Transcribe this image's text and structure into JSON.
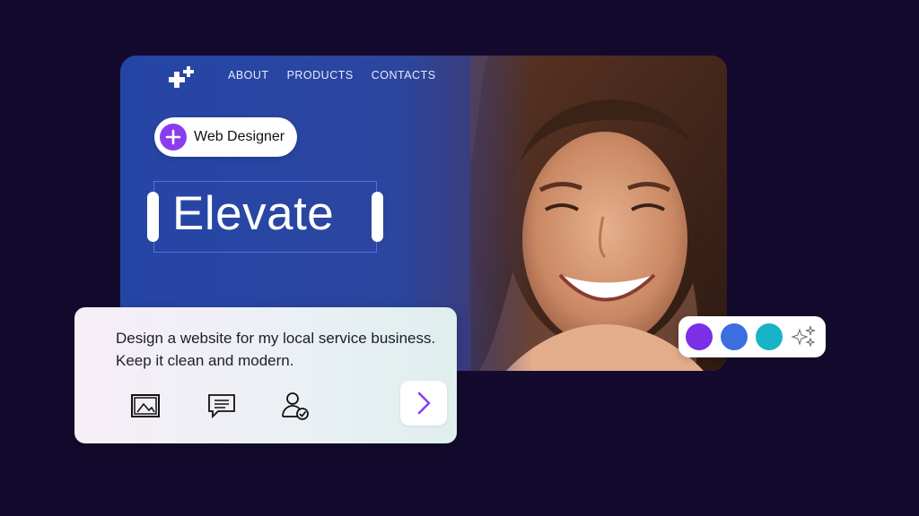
{
  "nav": {
    "items": [
      "ABOUT",
      "PRODUCTS",
      "CONTACTS"
    ]
  },
  "badge": {
    "label": "Web Designer",
    "icon": "plus-icon",
    "color": "#8a3df0"
  },
  "headline": {
    "text": "Elevate"
  },
  "prompt": {
    "text": "Design a website for my local service business. Keep it clean and modern.",
    "tools": [
      "image-icon",
      "chat-icon",
      "user-check-icon"
    ],
    "send_icon": "chevron-right-icon"
  },
  "palette": {
    "colors": [
      "#7b2fe6",
      "#3d6ee0",
      "#17b3c6"
    ],
    "extra_icon": "sparkle-icon"
  },
  "colors": {
    "background": "#130a2e",
    "hero_blue": "#2545a6",
    "accent": "#8a3df0"
  }
}
